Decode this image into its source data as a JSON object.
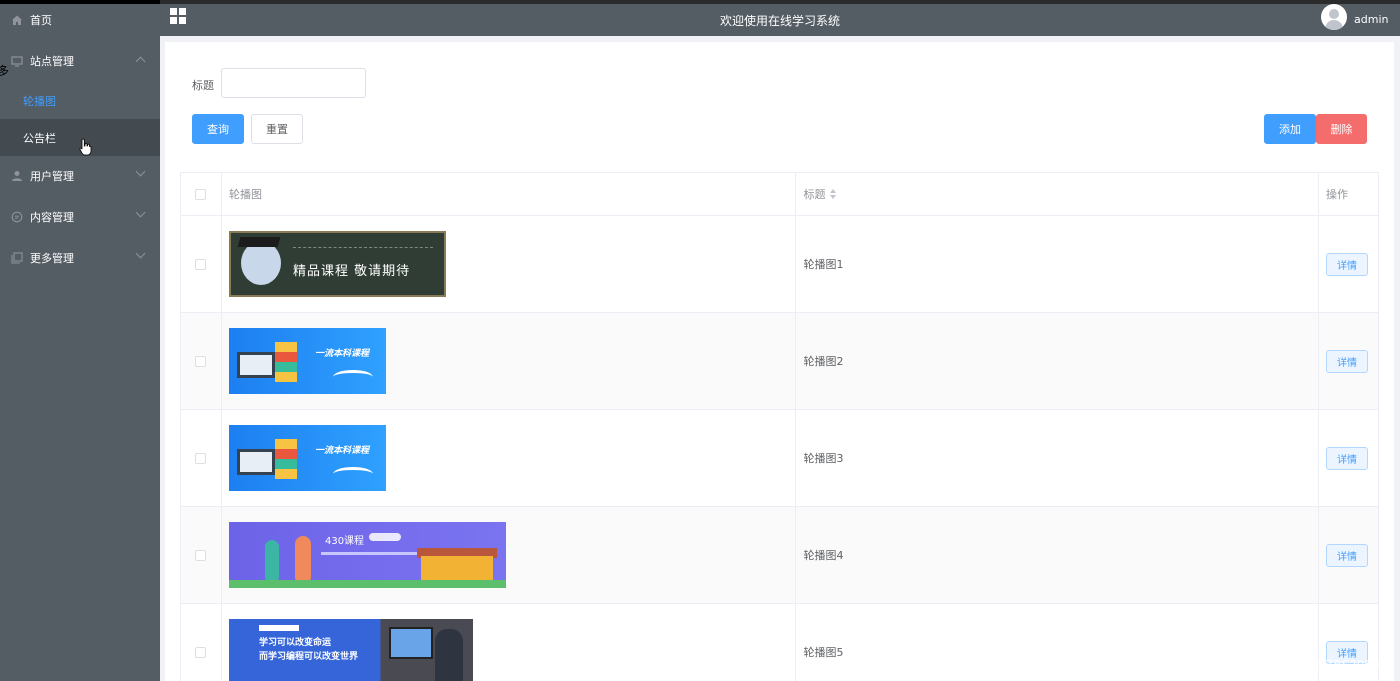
{
  "header": {
    "title": "欢迎使用在线学习系统",
    "username": "admin"
  },
  "sidebar": {
    "items": [
      {
        "label": "首页",
        "icon": "home-icon"
      },
      {
        "label": "站点管理",
        "icon": "monitor-icon",
        "expanded": true,
        "children": [
          {
            "label": "轮播图",
            "active": true
          },
          {
            "label": "公告栏",
            "hovered": true
          }
        ]
      },
      {
        "label": "用户管理",
        "icon": "user-icon"
      },
      {
        "label": "内容管理",
        "icon": "chat-icon"
      },
      {
        "label": "更多管理",
        "icon": "copy-icon"
      }
    ]
  },
  "search": {
    "title_label": "标题",
    "title_value": "",
    "search_label": "查询",
    "reset_label": "重置"
  },
  "actions": {
    "add_label": "添加",
    "delete_label": "删除"
  },
  "table": {
    "columns": [
      "轮播图",
      "标题",
      "操作"
    ],
    "rows": [
      {
        "banner": "精品课程 敬请期待",
        "title": "轮播图1",
        "action": "详情"
      },
      {
        "banner": "一流本科课程",
        "title": "轮播图2",
        "action": "详情"
      },
      {
        "banner": "一流本科课程",
        "title": "轮播图3",
        "action": "详情"
      },
      {
        "banner": "430课程",
        "title": "轮播图4",
        "action": "详情"
      },
      {
        "banner_lines": [
          "学习可以改变命运",
          "而学习编程可以改变世界"
        ],
        "title": "轮播图5",
        "action": "详情"
      }
    ]
  },
  "watermark": "CSDN @DZBS2000",
  "colors": {
    "sidebar_bg": "#545c64",
    "accent": "#409eff",
    "danger": "#f56c6c"
  }
}
